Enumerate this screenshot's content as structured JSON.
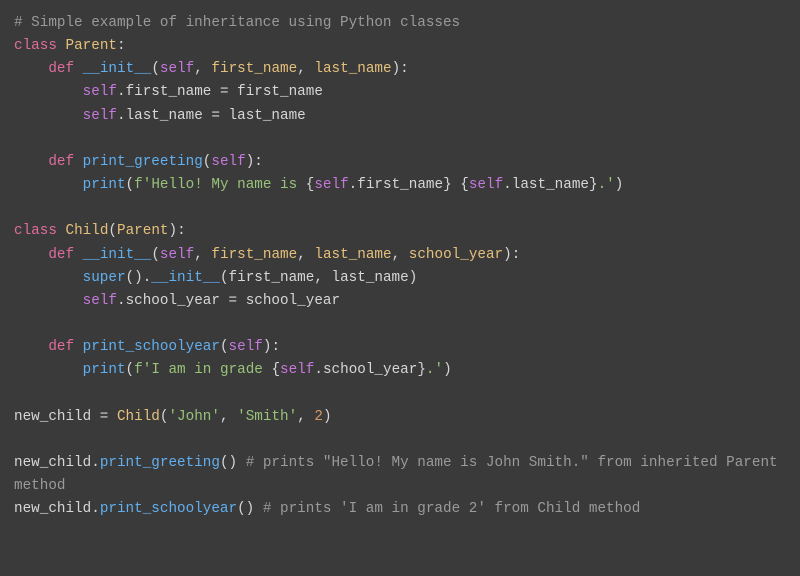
{
  "code": {
    "l01_comment": "# Simple example of inheritance using Python classes",
    "l02_kw_class": "class",
    "l02_cls_parent": "Parent",
    "l02_colon": ":",
    "l03_kw_def": "def",
    "l03_init": "__init__",
    "l03_self": "self",
    "l03_p1": "first_name",
    "l03_p2": "last_name",
    "l04_self": "self",
    "l04_attr": "first_name",
    "l04_rhs": "first_name",
    "l05_self": "self",
    "l05_attr": "last_name",
    "l05_rhs": "last_name",
    "l07_kw_def": "def",
    "l07_fn": "print_greeting",
    "l07_self": "self",
    "l08_print": "print",
    "l08_f": "f",
    "l08_s1": "'Hello! My name is ",
    "l08_e1a": "self",
    "l08_e1b": "first_name",
    "l08_s2": " ",
    "l08_e2a": "self",
    "l08_e2b": "last_name",
    "l08_s3": ".'",
    "l10_kw_class": "class",
    "l10_cls_child": "Child",
    "l10_base": "Parent",
    "l11_kw_def": "def",
    "l11_init": "__init__",
    "l11_self": "self",
    "l11_p1": "first_name",
    "l11_p2": "last_name",
    "l11_p3": "school_year",
    "l12_super": "super",
    "l12_init": "__init__",
    "l12_a1": "first_name",
    "l12_a2": "last_name",
    "l13_self": "self",
    "l13_attr": "school_year",
    "l13_rhs": "school_year",
    "l15_kw_def": "def",
    "l15_fn": "print_schoolyear",
    "l15_self": "self",
    "l16_print": "print",
    "l16_f": "f",
    "l16_s1": "'I am in grade ",
    "l16_e1a": "self",
    "l16_e1b": "school_year",
    "l16_s2": ".'",
    "l18_var": "new_child",
    "l18_cls": "Child",
    "l18_a1": "'John'",
    "l18_a2": "'Smith'",
    "l18_a3": "2",
    "l20_recv": "new_child",
    "l20_call": "print_greeting",
    "l20_comment": "# prints \"Hello! My name is John Smith.\" from inherited Parent method",
    "l22_recv": "new_child",
    "l22_call": "print_schoolyear",
    "l22_comment": "# prints 'I am in grade 2' from Child method"
  }
}
